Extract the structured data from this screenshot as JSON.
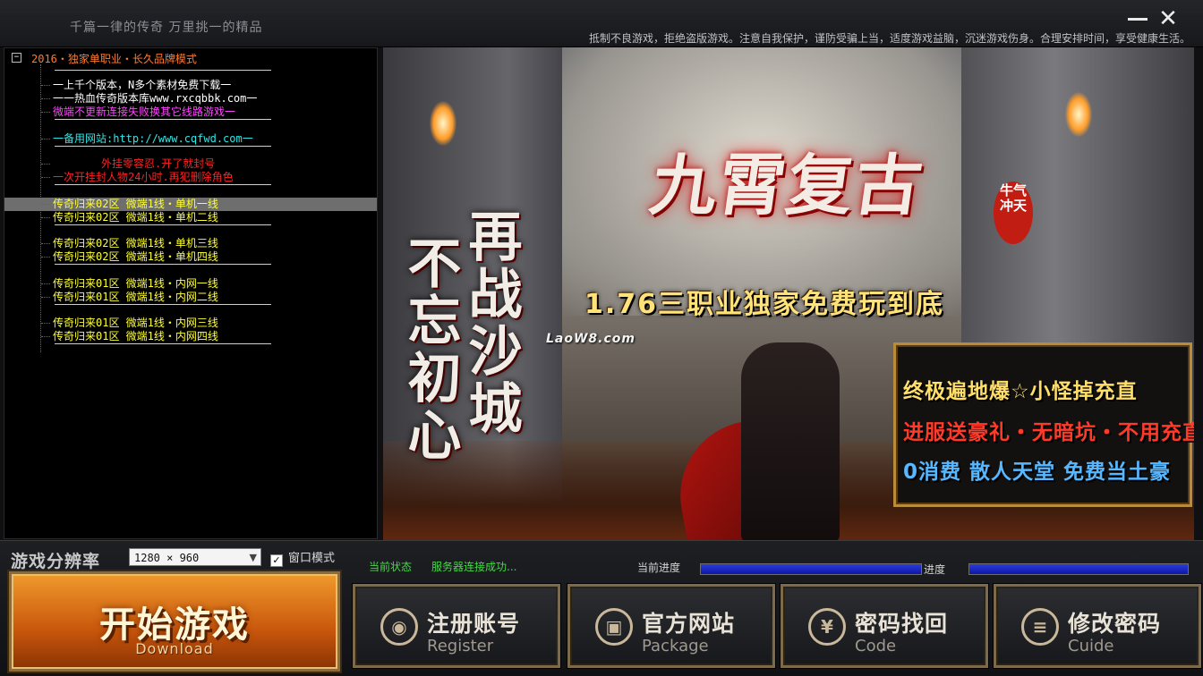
{
  "window": {
    "title": "千篇一律的传奇 万里挑一的精品",
    "notice": "抵制不良游戏，拒绝盗版游戏。注意自我保护，谨防受骗上当，适度游戏益脑，沉迷游戏伤身。合理安排时间，享受健康生活。",
    "min_icon": "minimize-icon",
    "close_label": "✕"
  },
  "tree": {
    "root_toggle": "−",
    "root_label": "2016・独家单职业・长久品牌模式",
    "rows": [
      {
        "text": "一上千个版本，N多个素材免费下载一",
        "color": "#ffffff"
      },
      {
        "text": "一一热血传奇版本库www.rxcqbbk.com一",
        "color": "#ffffff"
      },
      {
        "text": "微端不更新连接失败换其它线路游戏一",
        "color": "#ff44ff"
      },
      {
        "text": "一备用网站:http://www.cqfwd.com一",
        "color": "#2ee6e6"
      },
      {
        "text": "外挂零容忍.开了就封号",
        "color": "#ff2222"
      },
      {
        "text": "一次开挂封人物24小时.再犯删除角色",
        "color": "#ff2222"
      },
      {
        "text": "传奇归来02区   微端1线・单机一线",
        "color": "#ffff33"
      },
      {
        "text": "传奇归来02区   微端1线・单机二线",
        "color": "#ffff33"
      },
      {
        "text": "传奇归来02区   微端1线・单机三线",
        "color": "#ffff33"
      },
      {
        "text": "传奇归来02区   微端1线・单机四线",
        "color": "#ffff33"
      },
      {
        "text": "传奇归来01区   微端1线・内网一线",
        "color": "#ffff33"
      },
      {
        "text": "传奇归来01区   微端1线・内网二线",
        "color": "#ffff33"
      },
      {
        "text": "传奇归来01区   微端1线・内网三线",
        "color": "#ffff33"
      },
      {
        "text": "传奇归来01区   微端1线・内网四线",
        "color": "#ffff33"
      }
    ],
    "selected_index": 6
  },
  "banner": {
    "logo_side": "牛气冲天",
    "logo": "九霄复古",
    "tagline": "1.76三职业独家免费玩到底",
    "watermark": "LaoW8.com",
    "callig_1": "不忘初心",
    "callig_2": "再战沙城",
    "promo": {
      "line1": "终极遍地爆☆小怪掉充直",
      "line2": "进服送豪礼・无暗坑・不用充直",
      "line3": "0消费  散人天堂  免费当土豪"
    }
  },
  "settings": {
    "resolution_label": "游戏分辨率",
    "resolution_value": "1280 × 960",
    "resolution_arrow": "▼",
    "window_mode_label": "窗口模式",
    "window_mode_check": "✓",
    "window_mode_checked": true
  },
  "status": {
    "label": "当前状态",
    "value": "服务器连接成功...",
    "progress1_label": "当前进度",
    "progress1": 1.0,
    "progress2_label": "进度",
    "progress2": 1.0
  },
  "buttons": {
    "start": {
      "label": "开始游戏",
      "sub": "Download"
    },
    "register": {
      "label": "注册账号",
      "sub": "Register",
      "icon": "user-icon",
      "glyph": "◉"
    },
    "website": {
      "label": "官方网站",
      "sub": "Package",
      "icon": "gift-icon",
      "glyph": "▣"
    },
    "recover": {
      "label": "密码找回",
      "sub": "Code",
      "icon": "yen-icon",
      "glyph": "¥"
    },
    "change": {
      "label": "修改密码",
      "sub": "Cuide",
      "icon": "list-icon",
      "glyph": "≡"
    }
  }
}
